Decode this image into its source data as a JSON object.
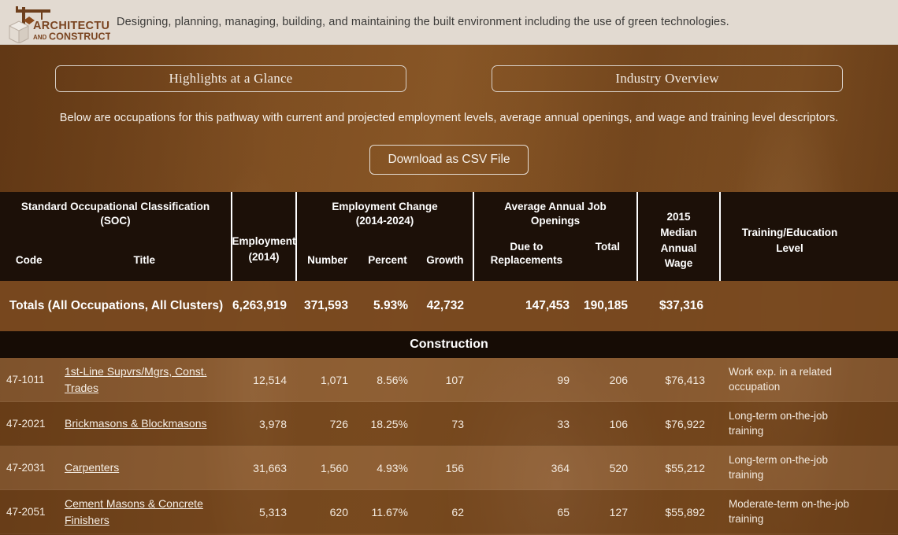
{
  "banner": {
    "logo_line1": "ARCHITECTURE",
    "logo_and": "AND",
    "logo_line2": "CONSTRUCTION",
    "logo_icon": "crane-and-block-icon",
    "tagline": "Designing, planning, managing, building, and maintaining the built environment including the use of green technologies."
  },
  "tabs": [
    {
      "label": "Highlights at a Glance"
    },
    {
      "label": "Industry Overview"
    }
  ],
  "intro": "Below are occupations for this pathway with current and projected employment levels, average annual openings, and wage and training level descriptors.",
  "download": {
    "label": "Download as CSV File"
  },
  "table": {
    "headers": {
      "soc_group": "Standard Occupational Classification (SOC)",
      "soc_group_line1": "Standard Occupational Classification",
      "soc_group_line2": "(SOC)",
      "code": "Code",
      "title": "Title",
      "employment": "Employment (2014)",
      "employment_line1": "Employment",
      "employment_line2": "(2014)",
      "change_group_line1": "Employment Change",
      "change_group_line2": "(2014-2024)",
      "number": "Number",
      "percent": "Percent",
      "growth": "Growth",
      "openings_group_line1": "Average Annual Job",
      "openings_group_line2": "Openings",
      "replacements_line1": "Due to",
      "replacements_line2": "Replacements",
      "total": "Total",
      "wage_line1": "2015",
      "wage_line2": "Median",
      "wage_line3": "Annual",
      "wage_line4": "Wage",
      "training_line1": "Training/Education",
      "training_line2": "Level"
    },
    "totals": {
      "label_line1": "Totals (All Occupations, All",
      "label_line2": "Clusters)",
      "employment": "6,263,919",
      "number": "371,593",
      "percent": "5.93%",
      "growth": "42,732",
      "replacements": "147,453",
      "total": "190,185",
      "wage": "$37,316"
    },
    "section": {
      "label": "Construction"
    },
    "rows": [
      {
        "code": "47-1011",
        "title": "1st-Line Supvrs/Mgrs, Const. Trades",
        "employment": "12,514",
        "number": "1,071",
        "percent": "8.56%",
        "growth": "107",
        "replacements": "99",
        "total": "206",
        "wage": "$76,413",
        "training": "Work exp. in a related occupation"
      },
      {
        "code": "47-2021",
        "title": "Brickmasons & Blockmasons",
        "employment": "3,978",
        "number": "726",
        "percent": "18.25%",
        "growth": "73",
        "replacements": "33",
        "total": "106",
        "wage": "$76,922",
        "training": "Long-term on-the-job training"
      },
      {
        "code": "47-2031",
        "title": "Carpenters",
        "employment": "31,663",
        "number": "1,560",
        "percent": "4.93%",
        "growth": "156",
        "replacements": "364",
        "total": "520",
        "wage": "$55,212",
        "training": "Long-term on-the-job training"
      },
      {
        "code": "47-2051",
        "title": "Cement Masons & Concrete Finishers",
        "employment": "5,313",
        "number": "620",
        "percent": "11.67%",
        "growth": "62",
        "replacements": "65",
        "total": "127",
        "wage": "$55,892",
        "training": "Moderate-term on-the-job training"
      }
    ]
  },
  "colors": {
    "banner_bg": "#e2dad1",
    "body_brown": "#7a4a20",
    "header_dark": "#1c1008",
    "accent_text": "#f6f1eb",
    "logo_brown": "#7a4420"
  }
}
